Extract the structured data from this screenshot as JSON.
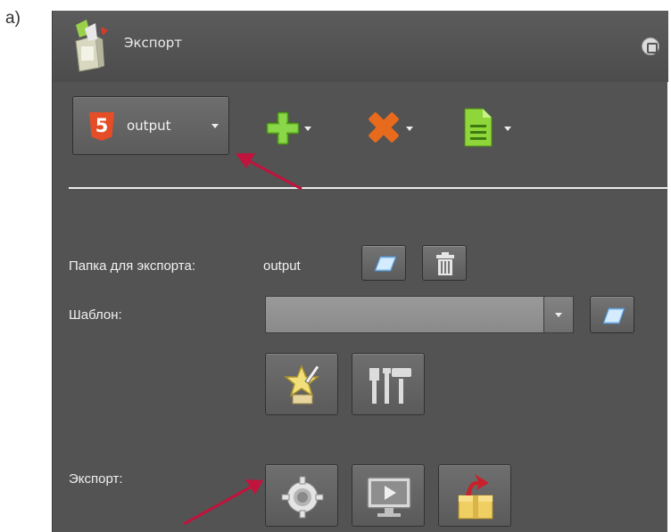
{
  "figure_label": "а)",
  "window": {
    "title": "Экспорт",
    "icon": "export-app-icon",
    "pin_icon": "pin-icon"
  },
  "toolbar": {
    "format": {
      "badge": "5",
      "label": "output",
      "icon": "html5-icon",
      "dropdown_icon": "chevron-down-icon"
    },
    "add_icon": "plus-icon",
    "remove_icon": "close-icon",
    "document_icon": "document-icon"
  },
  "form": {
    "export_folder_label": "Папка для экспорта:",
    "export_folder_value": "output",
    "template_label": "Шаблон:",
    "template_value": "",
    "export_label": "Экспорт:"
  },
  "colors": {
    "panel_bg": "#535353",
    "html5_orange": "#e44d26",
    "plus_green": "#6fbf2d",
    "cross_orange": "#e86a1c",
    "doc_green": "#8fd63a",
    "annotation_arrow": "#c0143c"
  }
}
